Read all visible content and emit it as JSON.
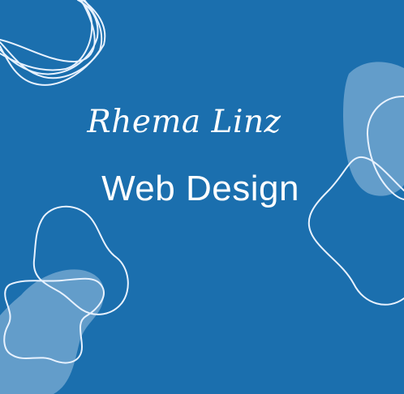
{
  "brand": {
    "signature": "Rhema Linz",
    "headline": "Web Design"
  },
  "colors": {
    "background": "#1b6fae",
    "text": "#ffffff",
    "outline": "#e8f2ff",
    "blob_fill": "#8fb9db"
  }
}
